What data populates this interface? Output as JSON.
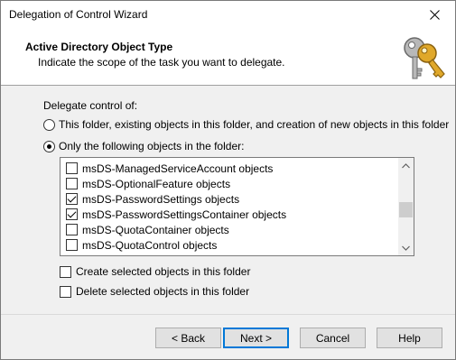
{
  "window": {
    "title": "Delegation of Control Wizard"
  },
  "header": {
    "title": "Active Directory Object Type",
    "subtitle": "Indicate the scope of the task you want to delegate.",
    "icon": "keys-icon"
  },
  "scope": {
    "label": "Delegate control of:",
    "options": [
      {
        "label": "This folder, existing objects in this folder, and creation of new objects in this folder",
        "selected": false
      },
      {
        "label": "Only the following objects in the folder:",
        "selected": true
      }
    ]
  },
  "object_list": {
    "items": [
      {
        "label": "msDS-ManagedServiceAccount objects",
        "checked": false
      },
      {
        "label": "msDS-OptionalFeature objects",
        "checked": false
      },
      {
        "label": "msDS-PasswordSettings objects",
        "checked": true
      },
      {
        "label": "msDS-PasswordSettingsContainer objects",
        "checked": true
      },
      {
        "label": "msDS-QuotaContainer objects",
        "checked": false
      },
      {
        "label": "msDS-QuotaControl objects",
        "checked": false
      }
    ]
  },
  "options": {
    "create_label": "Create selected objects in this folder",
    "create_checked": false,
    "delete_label": "Delete selected objects in this folder",
    "delete_checked": false
  },
  "buttons": {
    "back": "< Back",
    "next": "Next >",
    "cancel": "Cancel",
    "help": "Help"
  }
}
